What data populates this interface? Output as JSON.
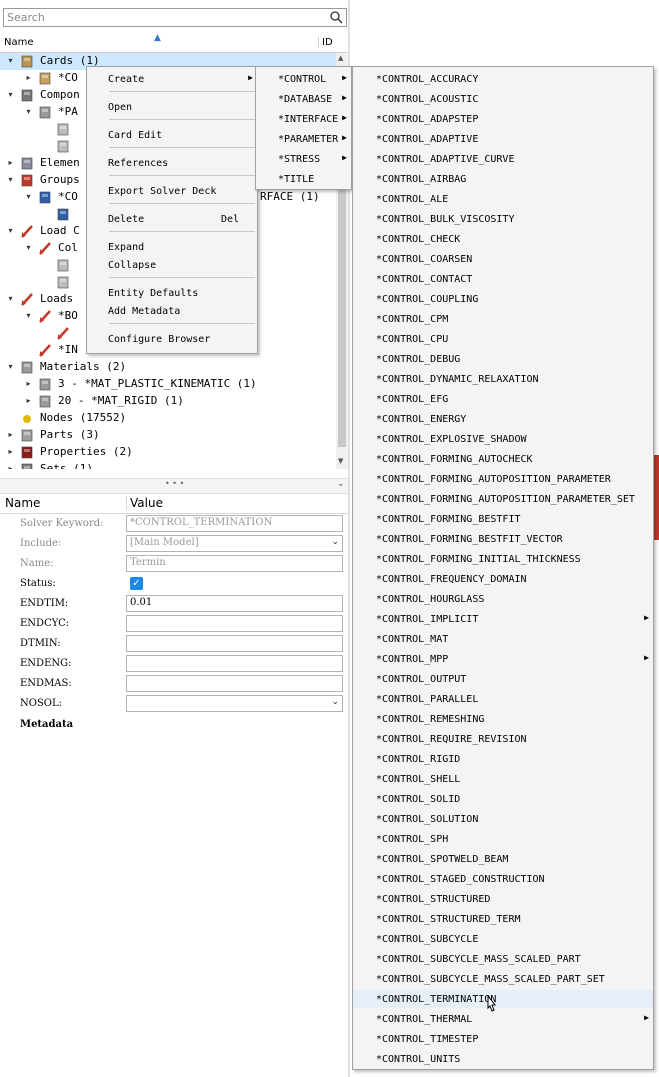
{
  "search": {
    "placeholder": "Search"
  },
  "tree_header": {
    "name": "Name",
    "id": "ID"
  },
  "tree": [
    {
      "label": "Cards (1)",
      "indent": 0,
      "toggle": "▾",
      "icon": "cards-icon"
    },
    {
      "label": "*CO",
      "indent": 1,
      "toggle": "▸",
      "icon": "card-icon"
    },
    {
      "label": "Compon",
      "indent": 0,
      "toggle": "▾",
      "icon": "component-icon"
    },
    {
      "label": "*PA",
      "indent": 1,
      "toggle": "▾",
      "icon": "part-icon"
    },
    {
      "label": "",
      "indent": 2,
      "toggle": "",
      "icon": "shell-icon"
    },
    {
      "label": "",
      "indent": 2,
      "toggle": "",
      "icon": "shell-icon"
    },
    {
      "label": "Elemen",
      "indent": 0,
      "toggle": "▸",
      "icon": "element-icon"
    },
    {
      "label": "Groups",
      "indent": 0,
      "toggle": "▾",
      "icon": "group-icon"
    },
    {
      "label": "*CO",
      "indent": 1,
      "toggle": "▾",
      "icon": "contact-icon"
    },
    {
      "label": "",
      "indent": 2,
      "toggle": "",
      "icon": "contact-icon"
    },
    {
      "label": "Load C",
      "indent": 0,
      "toggle": "▾",
      "icon": "load-collector-icon"
    },
    {
      "label": "Col",
      "indent": 1,
      "toggle": "▾",
      "icon": "load-collector-icon"
    },
    {
      "label": "",
      "indent": 2,
      "toggle": "",
      "icon": "shell-icon"
    },
    {
      "label": "",
      "indent": 2,
      "toggle": "",
      "icon": "shell-icon"
    },
    {
      "label": "Loads",
      "indent": 0,
      "toggle": "▾",
      "icon": "load-icon"
    },
    {
      "label": "*BO",
      "indent": 1,
      "toggle": "▾",
      "icon": "load-icon"
    },
    {
      "label": "",
      "indent": 2,
      "toggle": "",
      "icon": "load-icon"
    },
    {
      "label": "*IN",
      "indent": 1,
      "toggle": "",
      "icon": "load-icon"
    },
    {
      "label": "Materials (2)",
      "indent": 0,
      "toggle": "▾",
      "icon": "material-icon"
    },
    {
      "label": "3 - *MAT_PLASTIC_KINEMATIC (1)",
      "indent": 1,
      "toggle": "▸",
      "icon": "material-icon"
    },
    {
      "label": "20 - *MAT_RIGID (1)",
      "indent": 1,
      "toggle": "▸",
      "icon": "material-icon"
    },
    {
      "label": "Nodes (17552)",
      "indent": 0,
      "toggle": "",
      "icon": "node-icon"
    },
    {
      "label": "Parts (3)",
      "indent": 0,
      "toggle": "▸",
      "icon": "parts-icon"
    },
    {
      "label": "Properties (2)",
      "indent": 0,
      "toggle": "▸",
      "icon": "property-icon"
    },
    {
      "label": "Sets (1)",
      "indent": 0,
      "toggle": "▸",
      "icon": "set-icon"
    }
  ],
  "group_suffix": "RFACE (1)",
  "splitter_text": "• • •",
  "props_header": {
    "name": "Name",
    "value": "Value"
  },
  "props": [
    {
      "name": "Solver Keyword:",
      "value": "*CONTROL_TERMINATION",
      "dim": true,
      "kind": "text"
    },
    {
      "name": "Include:",
      "value": "[Main Model]",
      "dim": true,
      "kind": "select"
    },
    {
      "name": "Name:",
      "value": "Termin",
      "dim": true,
      "kind": "text"
    },
    {
      "name": "Status:",
      "value": "",
      "dim": false,
      "kind": "check"
    },
    {
      "name": "ENDTIM:",
      "value": "0.01",
      "dim": false,
      "kind": "text"
    },
    {
      "name": "ENDCYC:",
      "value": "",
      "dim": false,
      "kind": "text"
    },
    {
      "name": "DTMIN:",
      "value": "",
      "dim": false,
      "kind": "text"
    },
    {
      "name": "ENDENG:",
      "value": "",
      "dim": false,
      "kind": "text"
    },
    {
      "name": "ENDMAS:",
      "value": "",
      "dim": false,
      "kind": "text"
    },
    {
      "name": "NOSOL:",
      "value": "",
      "dim": false,
      "kind": "select"
    }
  ],
  "metadata_label": "Metadata",
  "context_menu": [
    {
      "label": "Create",
      "submenu": true,
      "shortcut": ""
    },
    {
      "label": "Open",
      "submenu": false,
      "shortcut": ""
    },
    {
      "label": "Card Edit",
      "submenu": false,
      "shortcut": ""
    },
    {
      "label": "References",
      "submenu": false,
      "shortcut": ""
    },
    {
      "label": "Export Solver Deck",
      "submenu": false,
      "shortcut": ""
    },
    {
      "label": "Delete",
      "submenu": false,
      "shortcut": "Del"
    },
    {
      "label": "Expand",
      "submenu": false,
      "shortcut": ""
    },
    {
      "label": "Collapse",
      "submenu": false,
      "shortcut": ""
    },
    {
      "label": "Entity Defaults",
      "submenu": false,
      "shortcut": ""
    },
    {
      "label": "Add Metadata",
      "submenu": false,
      "shortcut": ""
    },
    {
      "label": "Configure Browser",
      "submenu": false,
      "shortcut": ""
    }
  ],
  "create_menu": [
    {
      "label": "*CONTROL",
      "submenu": true
    },
    {
      "label": "*DATABASE",
      "submenu": true
    },
    {
      "label": "*INTERFACE",
      "submenu": true
    },
    {
      "label": "*PARAMETER",
      "submenu": true
    },
    {
      "label": "*STRESS",
      "submenu": true
    },
    {
      "label": "*TITLE",
      "submenu": false
    }
  ],
  "control_menu": [
    {
      "label": "*CONTROL_ACCURACY",
      "submenu": false
    },
    {
      "label": "*CONTROL_ACOUSTIC",
      "submenu": false
    },
    {
      "label": "*CONTROL_ADAPSTEP",
      "submenu": false
    },
    {
      "label": "*CONTROL_ADAPTIVE",
      "submenu": false
    },
    {
      "label": "*CONTROL_ADAPTIVE_CURVE",
      "submenu": false
    },
    {
      "label": "*CONTROL_AIRBAG",
      "submenu": false
    },
    {
      "label": "*CONTROL_ALE",
      "submenu": false
    },
    {
      "label": "*CONTROL_BULK_VISCOSITY",
      "submenu": false
    },
    {
      "label": "*CONTROL_CHECK",
      "submenu": false
    },
    {
      "label": "*CONTROL_COARSEN",
      "submenu": false
    },
    {
      "label": "*CONTROL_CONTACT",
      "submenu": false
    },
    {
      "label": "*CONTROL_COUPLING",
      "submenu": false
    },
    {
      "label": "*CONTROL_CPM",
      "submenu": false
    },
    {
      "label": "*CONTROL_CPU",
      "submenu": false
    },
    {
      "label": "*CONTROL_DEBUG",
      "submenu": false
    },
    {
      "label": "*CONTROL_DYNAMIC_RELAXATION",
      "submenu": false
    },
    {
      "label": "*CONTROL_EFG",
      "submenu": false
    },
    {
      "label": "*CONTROL_ENERGY",
      "submenu": false
    },
    {
      "label": "*CONTROL_EXPLOSIVE_SHADOW",
      "submenu": false
    },
    {
      "label": "*CONTROL_FORMING_AUTOCHECK",
      "submenu": false
    },
    {
      "label": "*CONTROL_FORMING_AUTOPOSITION_PARAMETER",
      "submenu": false
    },
    {
      "label": "*CONTROL_FORMING_AUTOPOSITION_PARAMETER_SET",
      "submenu": false
    },
    {
      "label": "*CONTROL_FORMING_BESTFIT",
      "submenu": false
    },
    {
      "label": "*CONTROL_FORMING_BESTFIT_VECTOR",
      "submenu": false
    },
    {
      "label": "*CONTROL_FORMING_INITIAL_THICKNESS",
      "submenu": false
    },
    {
      "label": "*CONTROL_FREQUENCY_DOMAIN",
      "submenu": false
    },
    {
      "label": "*CONTROL_HOURGLASS",
      "submenu": false
    },
    {
      "label": "*CONTROL_IMPLICIT",
      "submenu": true
    },
    {
      "label": "*CONTROL_MAT",
      "submenu": false
    },
    {
      "label": "*CONTROL_MPP",
      "submenu": true
    },
    {
      "label": "*CONTROL_OUTPUT",
      "submenu": false
    },
    {
      "label": "*CONTROL_PARALLEL",
      "submenu": false
    },
    {
      "label": "*CONTROL_REMESHING",
      "submenu": false
    },
    {
      "label": "*CONTROL_REQUIRE_REVISION",
      "submenu": false
    },
    {
      "label": "*CONTROL_RIGID",
      "submenu": false
    },
    {
      "label": "*CONTROL_SHELL",
      "submenu": false
    },
    {
      "label": "*CONTROL_SOLID",
      "submenu": false
    },
    {
      "label": "*CONTROL_SOLUTION",
      "submenu": false
    },
    {
      "label": "*CONTROL_SPH",
      "submenu": false
    },
    {
      "label": "*CONTROL_SPOTWELD_BEAM",
      "submenu": false
    },
    {
      "label": "*CONTROL_STAGED_CONSTRUCTION",
      "submenu": false
    },
    {
      "label": "*CONTROL_STRUCTURED",
      "submenu": false
    },
    {
      "label": "*CONTROL_STRUCTURED_TERM",
      "submenu": false
    },
    {
      "label": "*CONTROL_SUBCYCLE",
      "submenu": false
    },
    {
      "label": "*CONTROL_SUBCYCLE_MASS_SCALED_PART",
      "submenu": false
    },
    {
      "label": "*CONTROL_SUBCYCLE_MASS_SCALED_PART_SET",
      "submenu": false
    },
    {
      "label": "*CONTROL_TERMINATION",
      "submenu": false,
      "hovered": true
    },
    {
      "label": "*CONTROL_THERMAL",
      "submenu": true
    },
    {
      "label": "*CONTROL_TIMESTEP",
      "submenu": false
    },
    {
      "label": "*CONTROL_UNITS",
      "submenu": false
    }
  ],
  "colors": {
    "selection": "#cde8ff",
    "menu_bg": "#f4f4f4",
    "hover": "#e6eef8",
    "checkbox": "#1e88e5"
  }
}
